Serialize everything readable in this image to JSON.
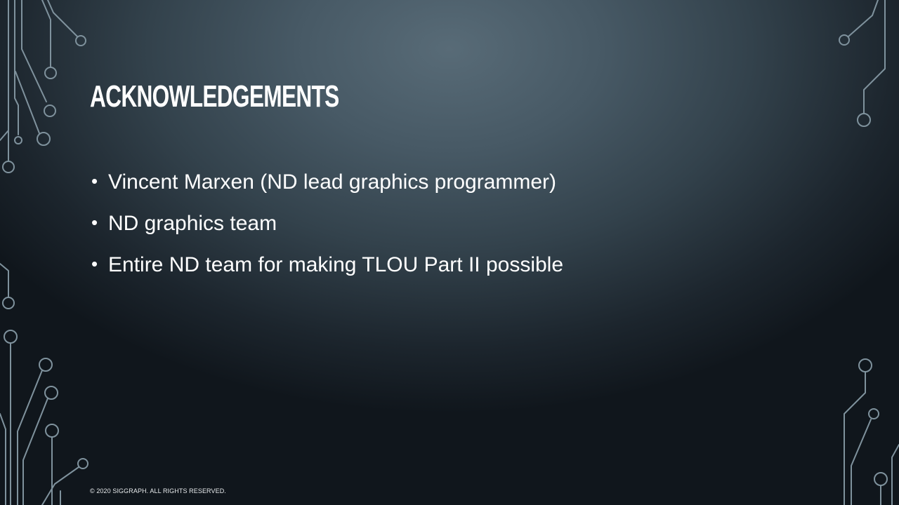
{
  "slide": {
    "title": "Acknowledgements",
    "bullet_symbol": "•",
    "bullets": [
      "Vincent Marxen (ND lead graphics programmer)",
      "ND graphics team",
      "Entire ND team for making TLOU Part II possible"
    ],
    "footer": "© 2020 SIGGRAPH. ALL RIGHTS RESERVED."
  },
  "colors": {
    "text": "#ffffff",
    "background_light": "#586b77",
    "background_dark": "#10161c",
    "circuit_line": "#7f929d"
  },
  "decoration": {
    "type": "circuit-line-pattern"
  }
}
